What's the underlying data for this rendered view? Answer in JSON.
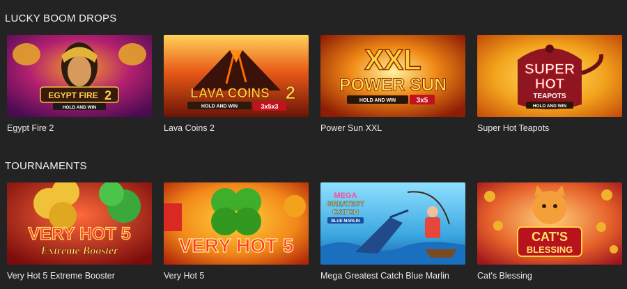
{
  "sections": [
    {
      "title": "LUCKY BOOM DROPS",
      "games": [
        {
          "name": "Egypt Fire 2",
          "icon": "egypt-fire-2-thumbnail",
          "logo_lines": [
            "EGYPT FIRE",
            "2"
          ],
          "tag": "HOLD AND WIN"
        },
        {
          "name": "Lava Coins 2",
          "icon": "lava-coins-2-thumbnail",
          "logo_lines": [
            "LAVA COINS",
            "2"
          ],
          "tag": "HOLD AND WIN",
          "extra": "3x5x3"
        },
        {
          "name": "Power Sun XXL",
          "icon": "power-sun-xxl-thumbnail",
          "logo_lines": [
            "XXL",
            "POWER SUN"
          ],
          "tag": "HOLD AND WIN",
          "extra": "3x5"
        },
        {
          "name": "Super Hot Teapots",
          "icon": "super-hot-teapots-thumbnail",
          "logo_lines": [
            "SUPER",
            "HOT",
            "TEAPOTS"
          ],
          "tag": "HOLD AND WIN"
        }
      ]
    },
    {
      "title": "TOURNAMENTS",
      "games": [
        {
          "name": "Very Hot 5 Extreme Booster",
          "icon": "very-hot-5-extreme-booster-thumbnail",
          "logo_lines": [
            "VERY HOT 5",
            "Extreme Booster"
          ]
        },
        {
          "name": "Very Hot 5",
          "icon": "very-hot-5-thumbnail",
          "logo_lines": [
            "VERY HOT 5"
          ]
        },
        {
          "name": "Mega Greatest Catch Blue Marlin",
          "icon": "mega-greatest-catch-thumbnail",
          "logo_lines": [
            "MEGA",
            "GREATEST",
            "CATCH",
            "BLUE MARLIN"
          ]
        },
        {
          "name": "Cat's Blessing",
          "icon": "cats-blessing-thumbnail",
          "logo_lines": [
            "CAT'S",
            "BLESSING"
          ]
        }
      ]
    }
  ]
}
